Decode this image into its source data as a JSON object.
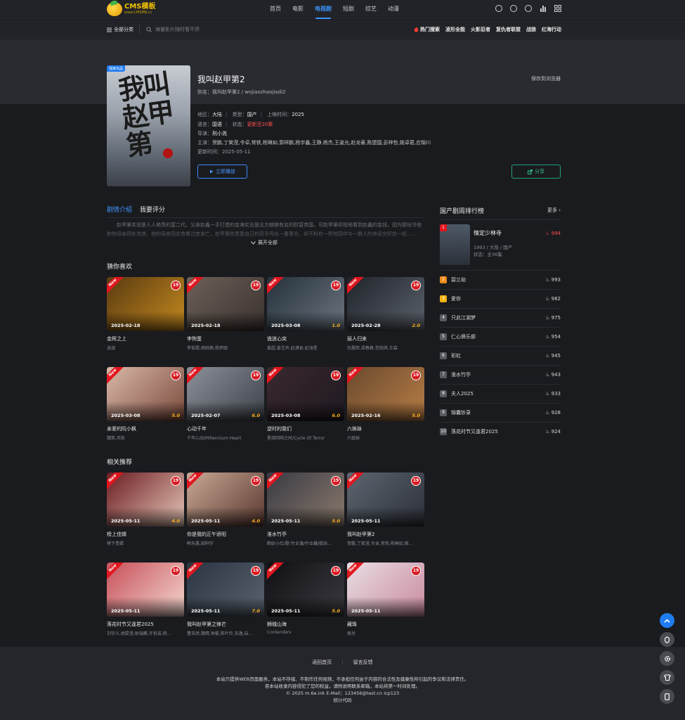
{
  "header": {
    "logo_text": "CMS模板",
    "logo_sub": "www.CMSMB.cc",
    "nav": [
      "首页",
      "电影",
      "电视剧",
      "短剧",
      "综艺",
      "动漫"
    ],
    "active_index": 2
  },
  "subbar": {
    "all_categories": "全部分类",
    "search_placeholder": "海量影片随时看不停",
    "hot_label": "热门搜索",
    "hot_items": [
      "凌形全能",
      "火影忍者",
      "复仇者联盟",
      "战狼",
      "红海行动"
    ]
  },
  "detail": {
    "badge": "独家出品",
    "poster_text": "我叫赵甲第",
    "title": "我叫赵甲第2",
    "alias_label": "别名：",
    "alias": "我叫赵甲第2 / wojiaozhaojiadi2",
    "save_label": "保存到浏览器",
    "region_label": "地区：",
    "region": "大陆",
    "type_label": "类型：",
    "type": "国产",
    "release_label": "上映时间：",
    "release": "2025",
    "lang_label": "语言：",
    "lang": "国语",
    "status_label": "状态：",
    "status": "更新至20集",
    "director_label": "导演：",
    "director": "刑小尧",
    "cast_label": "主演：",
    "cast": "贺鹏,丁笑滢,令卓,常铁,杨琳如,郭祥鹏,杨宇鑫,王静,杨杰,王姿允,赵龙豪,陈盟国,彭梓哲,姚卓君,应锦川",
    "updated_label": "更新时间：",
    "updated": "2025-05-11",
    "play_label": "立即播放",
    "share_label": "分享"
  },
  "tabs": [
    "剧情介绍",
    "我要评分"
  ],
  "synopsis": "赵甲第本该是人人艳羡的富二代，父亲赵鑫一手打造的金海实业是北方赫赫有名的财富帝国。可赵甲第却视地看到赵鑫的金钱，因为那份冷他和他母亲四处流浪，他的母亲因此劳累过度身亡。赵甲第执意靠自己的双手闯出一番事业，却不料在一所校园中与一群人的命运交织在一起……",
  "expand_label": "展开全部",
  "guess": {
    "title": "猜你喜欢",
    "items": [
      {
        "name": "金辉之上",
        "cast": "迪迦",
        "date": "2025-02-18",
        "score": "",
        "age": "19"
      },
      {
        "name": "李狗蛋",
        "cast": "李俊霞,胡晓楠,杨伊囡",
        "date": "2025-02-18",
        "score": "",
        "age": "19"
      },
      {
        "name": "诡迷心突",
        "cast": "姜超,姜艺声,赵潇食,妃海星",
        "date": "2025-03-08",
        "score": "1.0",
        "age": "19"
      },
      {
        "name": "丽人归来",
        "cast": "包晨熙,梁春峰,范晓琪,王森",
        "date": "2025-02-28",
        "score": "2.0",
        "age": "19"
      },
      {
        "name": "亲爱的阮小枫",
        "cast": "魏笑,邓凯",
        "date": "2025-03-08",
        "score": "5.0",
        "age": "19"
      },
      {
        "name": "心动千年",
        "cast": "千年心动/Millennium Heart",
        "date": "2025-02-07",
        "score": "6.0",
        "age": "19"
      },
      {
        "name": "逆时的我们",
        "cast": "星绎回响之时/Cycle Of Terror",
        "date": "2025-03-08",
        "score": "6.0",
        "age": "19"
      },
      {
        "name": "六姊妹",
        "cast": "六姐妹",
        "date": "2025-02-16",
        "score": "5.0",
        "age": "19"
      }
    ]
  },
  "related": {
    "title": "相关推荐",
    "items": [
      {
        "name": "榜上佳婿",
        "cast": "榜下贵婿",
        "date": "2025-05-11",
        "score": "4.0",
        "age": "19"
      },
      {
        "name": "你是我的正午骄阳",
        "cast": "韩东晨,田轩宇",
        "date": "2025-05-11",
        "score": "4.0",
        "age": "19"
      },
      {
        "name": "淮水竹亭",
        "cast": "鹤妖小红/歌:竹业蒲/竹业藕/狐妖...",
        "date": "2025-05-11",
        "score": "5.0",
        "age": "19"
      },
      {
        "name": "我叫赵甲第2",
        "cast": "贺鹏,丁笑滢,令卓,常铁,杨琳如,郭...",
        "date": "2025-05-11",
        "score": "",
        "age": "19"
      },
      {
        "name": "落花时节又逢君2025",
        "cast": "刘宇义,胡雯滢,耿瑞麒,许钒诺,杨...",
        "date": "2025-05-11",
        "score": "",
        "age": "19"
      },
      {
        "name": "我叫赵甲第之锋芒",
        "cast": "董浩然,魏晴,钟雾,陈叶玲,衣逸,启...",
        "date": "2025-05-11",
        "score": "7.0",
        "age": "19"
      },
      {
        "name": "狮城山海",
        "cast": "Contenders",
        "date": "2025-05-11",
        "score": "5.0",
        "age": "19"
      },
      {
        "name": "藏珠",
        "cast": "佩兒",
        "date": "2025-05-11",
        "score": "",
        "age": "19"
      }
    ]
  },
  "ranking": {
    "title": "国产剧周排行榜",
    "more": "更多",
    "top": {
      "rank": "1",
      "name": "情定少林寺",
      "info": "1993 / 大陆 / 国产",
      "status": "状态：全36集",
      "hot": "994"
    },
    "list": [
      {
        "rank": "2",
        "name": "碧兰劫",
        "hot": "993"
      },
      {
        "rank": "3",
        "name": "爱你",
        "hot": "982"
      },
      {
        "rank": "4",
        "name": "只此江湖梦",
        "hot": "975"
      },
      {
        "rank": "5",
        "name": "仁心俱乐部",
        "hot": "954"
      },
      {
        "rank": "6",
        "name": "彩虹",
        "hot": "945"
      },
      {
        "rank": "7",
        "name": "淮水竹亭",
        "hot": "943"
      },
      {
        "rank": "8",
        "name": "夫人2025",
        "hot": "933"
      },
      {
        "rank": "9",
        "name": "锦囊妙录",
        "hot": "928"
      },
      {
        "rank": "10",
        "name": "落花时节又逢君2025",
        "hot": "924"
      }
    ]
  },
  "footer": {
    "links": [
      "返回首页",
      "留言反馈"
    ],
    "line1": "本站只提供WEB页面服务，本站不存储、不制作任何视频，不承担任何由于内容的合法性及健康性所引起的争议和法律责任。",
    "line2": "若本站收录内容侵犯了您的权益，请附说明联系邮箱，本站将第一时间处理。",
    "line3": "© 2025 m.6e.ink  E-Mail：123456@test.cn  icp123",
    "line4": "统计代码"
  },
  "colors": {
    "accent": "#3d96ff",
    "hot": "#ff4d4d",
    "share": "#2fbf8b",
    "badge": "#e1161e"
  }
}
